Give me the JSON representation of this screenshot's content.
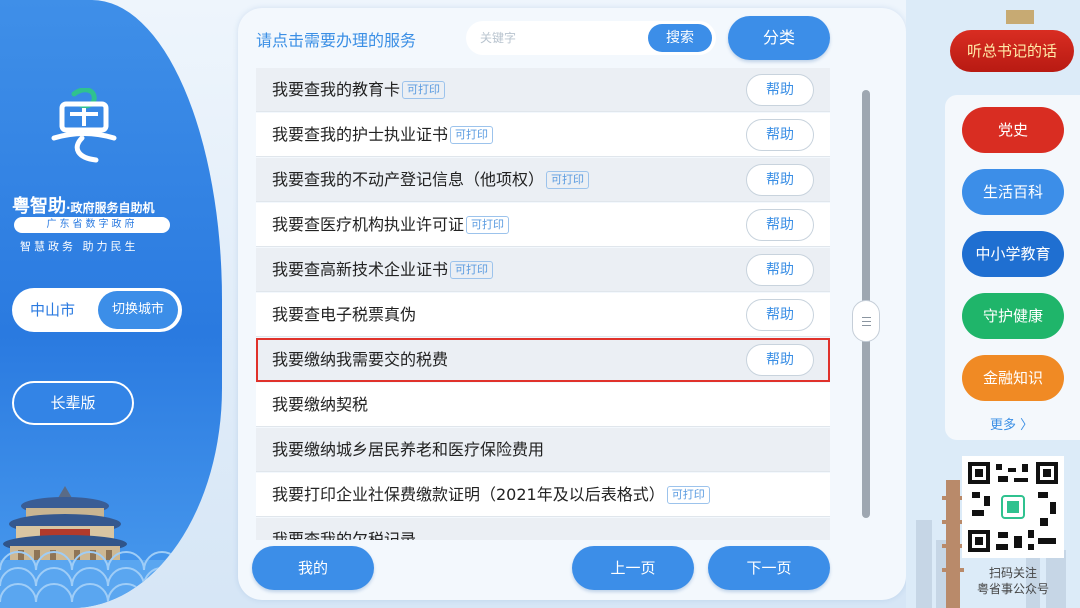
{
  "left": {
    "brand_name": "粤智助",
    "brand_sub": "·政府服务自助机",
    "brand_pill": "广东省数字政府",
    "slogan": "智慧政务  助力民生",
    "city": "中山市",
    "switch_city": "切换城市",
    "elder_mode": "长辈版"
  },
  "header": {
    "prompt": "请点击需要办理的服务",
    "search_placeholder": "关键字",
    "search_button": "搜索",
    "category_button": "分类"
  },
  "services": [
    {
      "label": "我要查我的教育卡",
      "printable": "可打印",
      "help": "帮助"
    },
    {
      "label": "我要查我的护士执业证书",
      "printable": "可打印",
      "help": "帮助"
    },
    {
      "label": "我要查我的不动产登记信息（他项权）",
      "printable": "可打印",
      "help": "帮助"
    },
    {
      "label": "我要查医疗机构执业许可证",
      "printable": "可打印",
      "help": "帮助"
    },
    {
      "label": "我要查高新技术企业证书",
      "printable": "可打印",
      "help": "帮助"
    },
    {
      "label": "我要查电子税票真伪",
      "printable": "",
      "help": "帮助"
    },
    {
      "label": "我要缴纳我需要交的税费",
      "printable": "",
      "help": "帮助"
    },
    {
      "label": "我要缴纳契税",
      "printable": "",
      "help": ""
    },
    {
      "label": "我要缴纳城乡居民养老和医疗保险费用",
      "printable": "",
      "help": ""
    },
    {
      "label": "我要打印企业社保费缴款证明（2021年及以后表格式）",
      "printable": "可打印",
      "help": ""
    },
    {
      "label": "我要查我的欠税记录",
      "printable": "",
      "help": ""
    }
  ],
  "footer": {
    "mine": "我的",
    "prev": "上一页",
    "next": "下一页"
  },
  "right": {
    "speech": "听总书记的话",
    "items": [
      {
        "label": "党史",
        "color": "#d92d22"
      },
      {
        "label": "生活百科",
        "color": "#3c8ee8"
      },
      {
        "label": "中小学教育",
        "color": "#1f6fd1"
      },
      {
        "label": "守护健康",
        "color": "#1fb56a"
      },
      {
        "label": "金融知识",
        "color": "#f08a24"
      }
    ],
    "more": "更多 〉",
    "qr_caption_1": "扫码关注",
    "qr_caption_2": "粤省事公众号"
  },
  "colors": {
    "accent": "#3c8ee8",
    "highlight": "#e0322b"
  }
}
